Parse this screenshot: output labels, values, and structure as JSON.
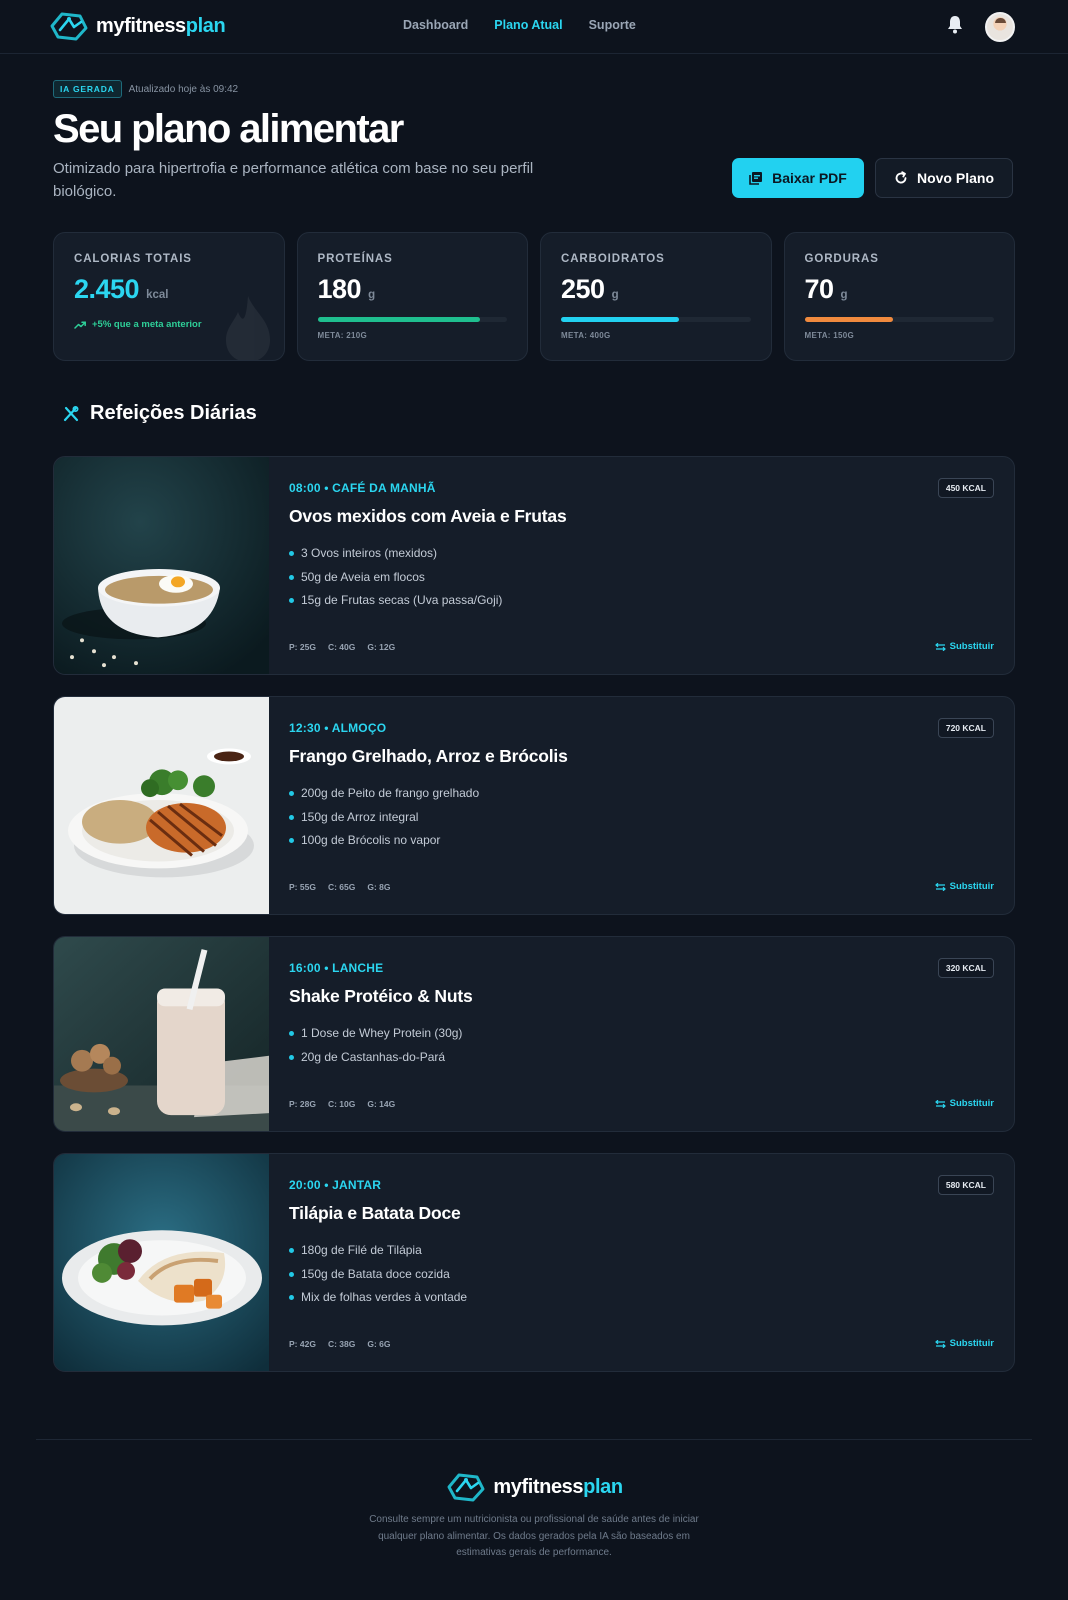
{
  "header": {
    "brand_part1": "myfitness",
    "brand_part2": "plan",
    "nav": [
      "Dashboard",
      "Plano Atual",
      "Suporte"
    ],
    "active_nav": "Plano Atual",
    "icons": [
      "logo-icon",
      "bell-icon",
      "avatar"
    ]
  },
  "hero": {
    "badge": "IA GERADA",
    "updated": "Atualizado hoje às 09:42",
    "title": "Seu plano alimentar",
    "subtitle": "Otimizado para hipertrofia e performance atlética com base no seu perfil biológico.",
    "download_label": "Baixar PDF",
    "new_plan_label": "Novo Plano"
  },
  "stats": [
    {
      "label": "CALORIAS TOTAIS",
      "value": "2.450",
      "unit": "kcal",
      "trend": "+5% que a meta anterior"
    },
    {
      "label": "PROTEÍNAS",
      "value": "180",
      "unit": "g",
      "goal": "META: 210G",
      "progress": 0.857,
      "color": "#1fbf8f"
    },
    {
      "label": "CARBOIDRATOS",
      "value": "250",
      "unit": "g",
      "goal": "META: 400G",
      "progress": 0.625,
      "color": "#22d1f0"
    },
    {
      "label": "GORDURAS",
      "value": "70",
      "unit": "g",
      "goal": "META: 150G",
      "progress": 0.467,
      "color": "#f08a3e"
    }
  ],
  "colors": {
    "accent": "#2bd6f0",
    "trend": "#2ecf98",
    "background": "#0d131d",
    "card": "#151d29"
  },
  "meals_section_title": "Refeições Diárias",
  "meals": [
    {
      "time": "08:00 • CAFÉ DA MANHÃ",
      "kcal": "450 KCAL",
      "title": "Ovos mexidos com Aveia e Frutas",
      "items": [
        "3 Ovos inteiros (mexidos)",
        "50g de Aveia em flocos",
        "15g de Frutas secas (Uva passa/Goji)"
      ],
      "p": "P: 25G",
      "c": "C: 40G",
      "g": "G: 12G",
      "swap": "Substituir"
    },
    {
      "time": "12:30 • ALMOÇO",
      "kcal": "720 KCAL",
      "title": "Frango Grelhado, Arroz e Brócolis",
      "items": [
        "200g de Peito de frango grelhado",
        "150g de Arroz integral",
        "100g de Brócolis no vapor"
      ],
      "p": "P: 55G",
      "c": "C: 65G",
      "g": "G: 8G",
      "swap": "Substituir"
    },
    {
      "time": "16:00 • LANCHE",
      "kcal": "320 KCAL",
      "title": "Shake Protéico & Nuts",
      "items": [
        "1 Dose de Whey Protein (30g)",
        "20g de Castanhas-do-Pará"
      ],
      "p": "P: 28G",
      "c": "C: 10G",
      "g": "G: 14G",
      "swap": "Substituir"
    },
    {
      "time": "20:00 • JANTAR",
      "kcal": "580 KCAL",
      "title": "Tilápia e Batata Doce",
      "items": [
        "180g de Filé de Tilápia",
        "150g de Batata doce cozida",
        "Mix de folhas verdes à vontade"
      ],
      "p": "P: 42G",
      "c": "C: 38G",
      "g": "G: 6G",
      "swap": "Substituir"
    }
  ],
  "footer": {
    "note": "Consulte sempre um nutricionista ou profissional de saúde antes de iniciar qualquer plano alimentar. Os dados gerados pela IA são baseados em estimativas gerais de performance."
  }
}
